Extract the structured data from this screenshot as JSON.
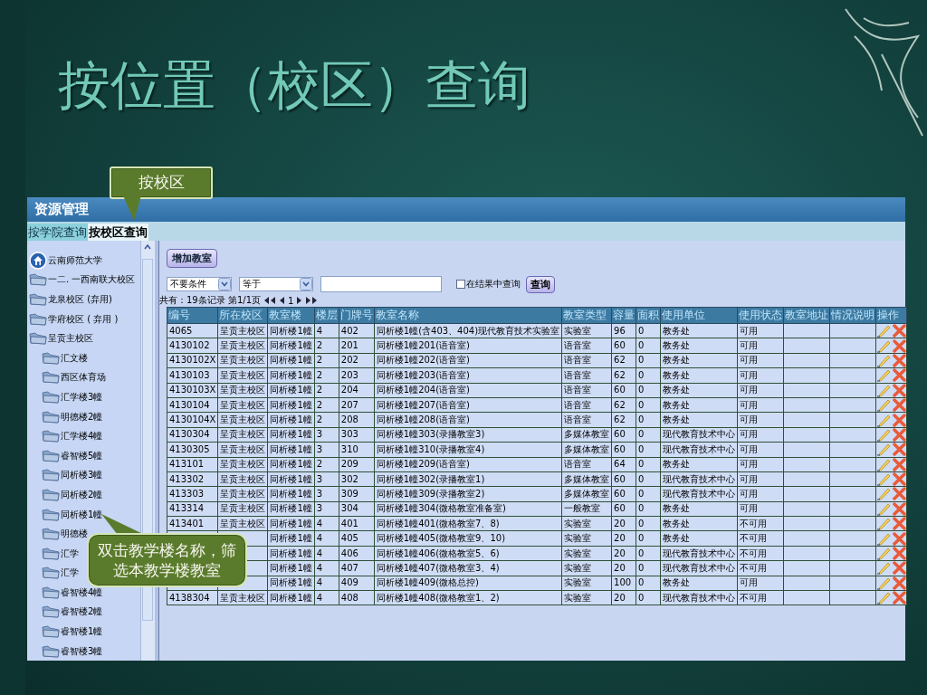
{
  "slide": {
    "title": "按位置（校区）查询",
    "callouts": [
      {
        "text": "按校区"
      },
      {
        "text": "双击教学楼名称，筛选本教学楼教室"
      }
    ]
  },
  "app": {
    "title": "资源管理",
    "tabs": [
      {
        "label": "按学院查询",
        "selected": false
      },
      {
        "label": "按校区查询",
        "selected": true
      }
    ],
    "tree": {
      "label": "云南师范大学",
      "children": [
        {
          "label": "一二. 一西南联大校区"
        },
        {
          "label": "龙泉校区 (弃用)"
        },
        {
          "label": "学府校区 ( 弃用 )"
        },
        {
          "label": "呈贡主校区",
          "children": [
            {
              "label": "汇文楼"
            },
            {
              "label": "西区体育场"
            },
            {
              "label": "汇学楼3幢"
            },
            {
              "label": "明德楼2幢"
            },
            {
              "label": "汇学楼4幢"
            },
            {
              "label": "睿智楼5幢"
            },
            {
              "label": "同析楼3幢"
            },
            {
              "label": "同析楼2幢"
            },
            {
              "label": "同析楼1幢"
            },
            {
              "label": "明德楼"
            },
            {
              "label": "汇学"
            },
            {
              "label": "汇学"
            },
            {
              "label": "睿智楼4幢"
            },
            {
              "label": "睿智楼2幢"
            },
            {
              "label": "睿智楼1幢"
            },
            {
              "label": "睿智楼3幢"
            }
          ]
        }
      ]
    },
    "toolbar": {
      "add_button": "增加教室",
      "condition_select": "不要条件",
      "operator_select": "等于",
      "in_results": {
        "label": "在结果中查询",
        "checked": false
      },
      "search_button": "查询"
    },
    "pager": {
      "summary": "共有：19条记录 第1/1页",
      "page": "1"
    },
    "table": {
      "columns": [
        "编号",
        "所在校区",
        "教室楼",
        "楼层",
        "门牌号",
        "教室名称",
        "教室类型",
        "容量",
        "面积",
        "使用单位",
        "使用状态",
        "教室地址",
        "情况说明",
        "操作"
      ],
      "rows": [
        {
          "cells": [
            "4065",
            "呈贡主校区",
            "同析楼1幢",
            "4",
            "402",
            "同析楼1幢(含403、404)现代教育技术实验室",
            "实验室",
            "96",
            "0",
            "教务处",
            "可用"
          ]
        },
        {
          "cells": [
            "4130102",
            "呈贡主校区",
            "同析楼1幢",
            "2",
            "201",
            "同析楼1幢201(语音室)",
            "语音室",
            "60",
            "0",
            "教务处",
            "可用"
          ]
        },
        {
          "cells": [
            "4130102X",
            "呈贡主校区",
            "同析楼1幢",
            "2",
            "202",
            "同析楼1幢202(语音室)",
            "语音室",
            "62",
            "0",
            "教务处",
            "可用"
          ]
        },
        {
          "cells": [
            "4130103",
            "呈贡主校区",
            "同析楼1幢",
            "2",
            "203",
            "同析楼1幢203(语音室)",
            "语音室",
            "62",
            "0",
            "教务处",
            "可用"
          ]
        },
        {
          "cells": [
            "4130103X",
            "呈贡主校区",
            "同析楼1幢",
            "2",
            "204",
            "同析楼1幢204(语音室)",
            "语音室",
            "60",
            "0",
            "教务处",
            "可用"
          ]
        },
        {
          "cells": [
            "4130104",
            "呈贡主校区",
            "同析楼1幢",
            "2",
            "207",
            "同析楼1幢207(语音室)",
            "语音室",
            "62",
            "0",
            "教务处",
            "可用"
          ]
        },
        {
          "cells": [
            "4130104X",
            "呈贡主校区",
            "同析楼1幢",
            "2",
            "208",
            "同析楼1幢208(语音室)",
            "语音室",
            "62",
            "0",
            "教务处",
            "可用"
          ]
        },
        {
          "cells": [
            "4130304",
            "呈贡主校区",
            "同析楼1幢",
            "3",
            "303",
            "同析楼1幢303(录播教室3)",
            "多媒体教室",
            "60",
            "0",
            "现代教育技术中心",
            "可用"
          ]
        },
        {
          "cells": [
            "4130305",
            "呈贡主校区",
            "同析楼1幢",
            "3",
            "310",
            "同析楼1幢310(录播教室4)",
            "多媒体教室",
            "60",
            "0",
            "现代教育技术中心",
            "可用"
          ]
        },
        {
          "cells": [
            "413101",
            "呈贡主校区",
            "同析楼1幢",
            "2",
            "209",
            "同析楼1幢209(语音室)",
            "语音室",
            "64",
            "0",
            "教务处",
            "可用"
          ]
        },
        {
          "cells": [
            "413302",
            "呈贡主校区",
            "同析楼1幢",
            "3",
            "302",
            "同析楼1幢302(录播教室1)",
            "多媒体教室",
            "60",
            "0",
            "现代教育技术中心",
            "可用"
          ]
        },
        {
          "cells": [
            "413303",
            "呈贡主校区",
            "同析楼1幢",
            "3",
            "309",
            "同析楼1幢309(录播教室2)",
            "多媒体教室",
            "60",
            "0",
            "现代教育技术中心",
            "可用"
          ]
        },
        {
          "cells": [
            "413314",
            "呈贡主校区",
            "同析楼1幢",
            "3",
            "304",
            "同析楼1幢304(微格教室准备室)",
            "一般教室",
            "60",
            "0",
            "教务处",
            "可用"
          ]
        },
        {
          "cells": [
            "413401",
            "呈贡主校区",
            "同析楼1幢",
            "4",
            "401",
            "同析楼1幢401(微格教室7、8)",
            "实验室",
            "20",
            "0",
            "教务处",
            "不可用"
          ]
        },
        {
          "cells": [
            null,
            null,
            "同析楼1幢",
            "4",
            "405",
            "同析楼1幢405(微格教室9、10)",
            "实验室",
            "20",
            "0",
            "教务处",
            "不可用"
          ]
        },
        {
          "cells": [
            null,
            null,
            "同析楼1幢",
            "4",
            "406",
            "同析楼1幢406(微格教室5、6)",
            "实验室",
            "20",
            "0",
            "现代教育技术中心",
            "不可用"
          ]
        },
        {
          "cells": [
            null,
            null,
            "同析楼1幢",
            "4",
            "407",
            "同析楼1幢407(微格教室3、4)",
            "实验室",
            "20",
            "0",
            "现代教育技术中心",
            "不可用"
          ]
        },
        {
          "cells": [
            null,
            null,
            "同析楼1幢",
            "4",
            "409",
            "同析楼1幢409(微格总控)",
            "实验室",
            "100",
            "0",
            "教务处",
            "可用"
          ]
        },
        {
          "cells": [
            "4138304",
            "呈贡主校区",
            "同析楼1幢",
            "4",
            "408",
            "同析楼1幢408(微格教室1、2)",
            "实验室",
            "20",
            "0",
            "现代教育技术中心",
            "不可用"
          ]
        }
      ]
    }
  }
}
